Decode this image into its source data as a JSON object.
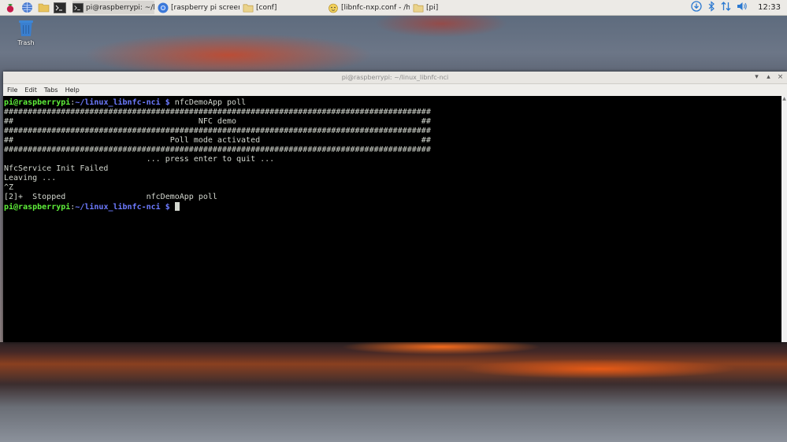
{
  "taskbar": {
    "tasks": [
      {
        "label": "pi@raspberrypi: ~/lin...",
        "icon": "terminal-icon",
        "active": true
      },
      {
        "label": "[raspberry pi screen c...",
        "icon": "chromium-icon"
      },
      {
        "label": "[conf]",
        "icon": "folder-icon"
      },
      {
        "label": "[libnfc-nxp.conf - /ho...",
        "icon": "text-editor-icon"
      },
      {
        "label": "[pi]",
        "icon": "folder-icon"
      }
    ],
    "clock": "12:33"
  },
  "desktop": {
    "trash_label": "Trash"
  },
  "window": {
    "title": "pi@raspberrypi: ~/linux_libnfc-nci",
    "controls": {
      "minimize": "▾",
      "maximize": "▴",
      "close": "×"
    },
    "menu": [
      "File",
      "Edit",
      "Tabs",
      "Help"
    ]
  },
  "terminal": {
    "prompt_user": "pi@raspberrypi",
    "prompt_path": "~/linux_libnfc-nci",
    "prompt_symbol": "$",
    "command": "nfcDemoApp poll",
    "output": [
      "##########################################################################################",
      "##                                       NFC demo                                       ##",
      "##########################################################################################",
      "##                                 Poll mode activated                                  ##",
      "##########################################################################################",
      "                              ... press enter to quit ...",
      "",
      "NfcService Init Failed",
      "Leaving ...",
      "",
      "^Z",
      "[2]+  Stopped                 nfcDemoApp poll"
    ]
  },
  "colors": {
    "prompt_user": "#5ff03a",
    "prompt_path": "#6d7bff",
    "terminal_bg": "#000000",
    "terminal_fg": "#d3d7cf"
  }
}
